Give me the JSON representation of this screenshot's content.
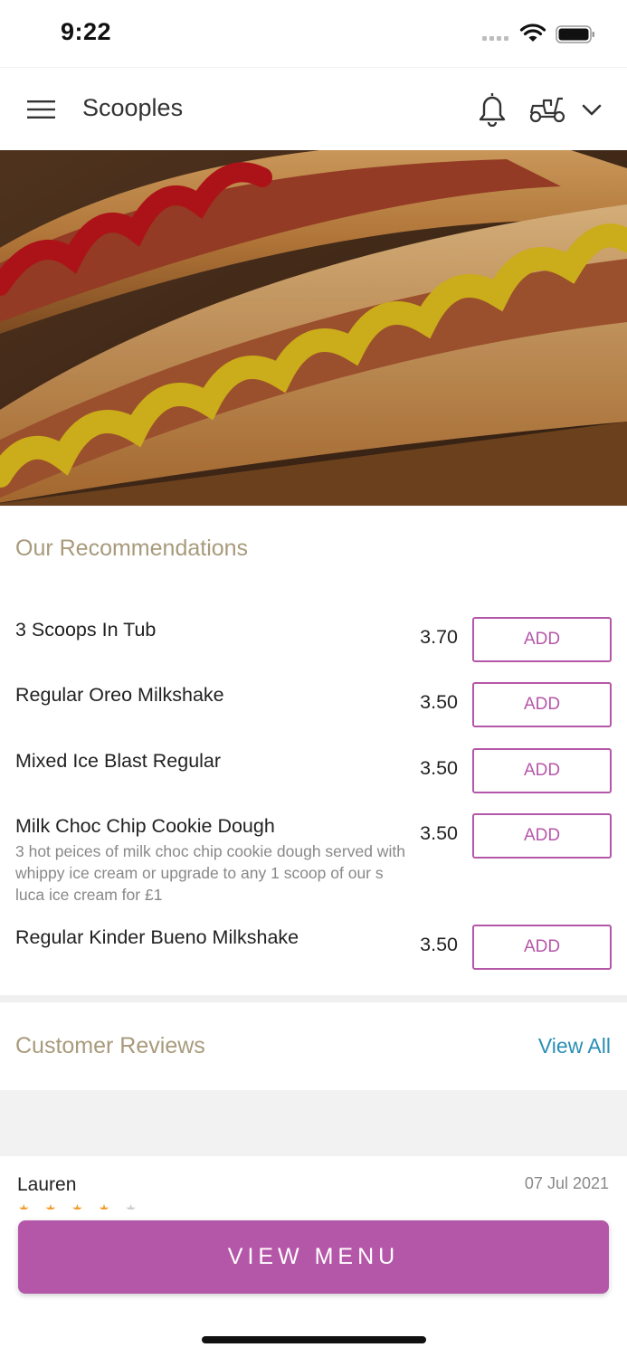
{
  "status_bar": {
    "time": "9:22"
  },
  "header": {
    "title": "Scooples",
    "icons": {
      "menu": "menu-icon",
      "bell": "bell-icon",
      "delivery": "scooter-icon",
      "dropdown": "chevron-down-icon"
    }
  },
  "hero": {
    "icon": "hotdog-hero-image"
  },
  "recommendations": {
    "title": "Our Recommendations",
    "items": [
      {
        "name": "3 Scoops In Tub",
        "price": "3.70",
        "description": "",
        "add_label": "ADD"
      },
      {
        "name": "Regular Oreo Milkshake",
        "price": "3.50",
        "description": "",
        "add_label": "ADD"
      },
      {
        "name": "Mixed Ice Blast Regular",
        "price": "3.50",
        "description": "",
        "add_label": "ADD"
      },
      {
        "name": "Milk Choc Chip Cookie Dough",
        "price": "3.50",
        "description": "3 hot peices of milk choc chip cookie dough served with whippy ice cream or upgrade to any 1 scoop of our s luca ice cream for £1",
        "add_label": "ADD"
      },
      {
        "name": "Regular Kinder Bueno Milkshake",
        "price": "3.50",
        "description": "",
        "add_label": "ADD"
      }
    ]
  },
  "reviews": {
    "title": "Customer Reviews",
    "view_all": "View All",
    "items": [
      {
        "name": "Lauren",
        "date": "07 Jul 2021",
        "rating": 4,
        "max_rating": 5
      }
    ]
  },
  "footer": {
    "view_menu_label": "VIEW MENU"
  },
  "colors": {
    "accent": "#b557a8",
    "section_title": "#a89a7b",
    "link": "#2a8fb5"
  }
}
